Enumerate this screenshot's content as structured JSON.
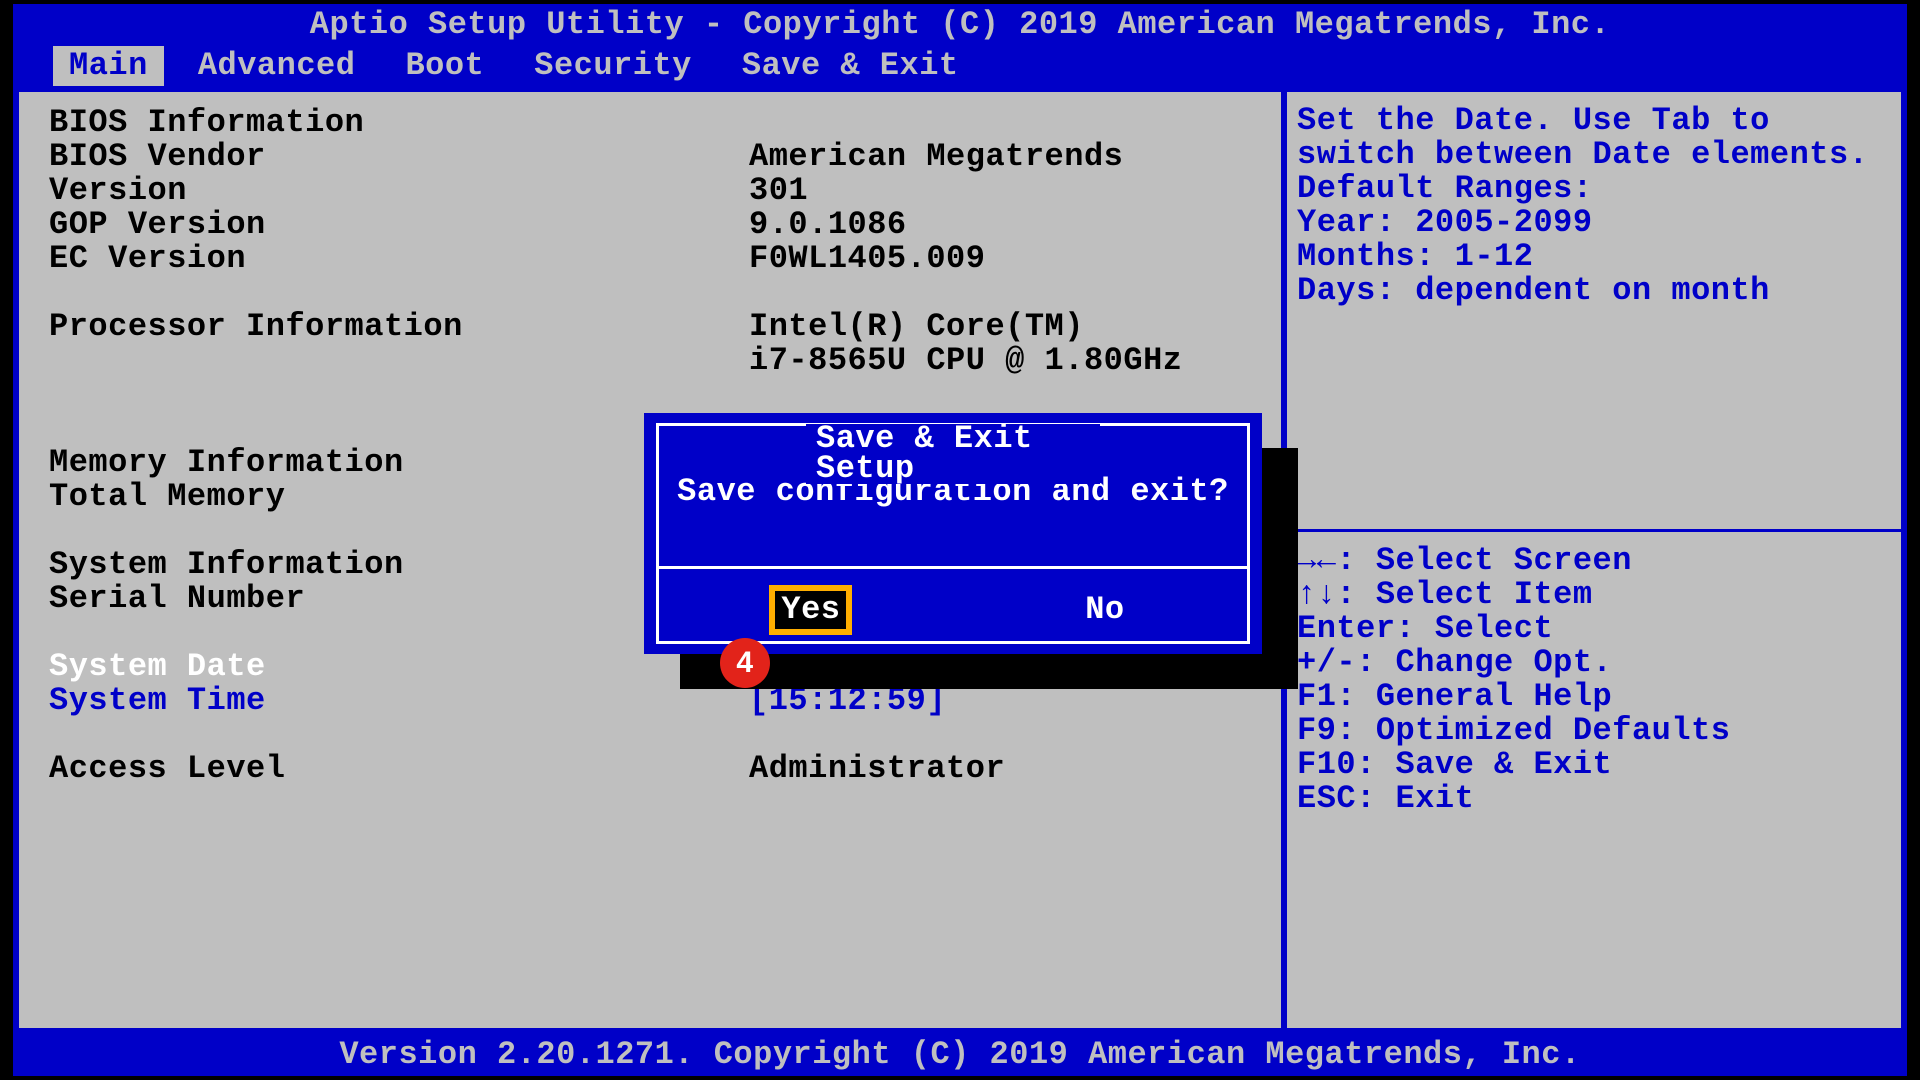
{
  "title": "Aptio Setup Utility - Copyright (C) 2019 American Megatrends, Inc.",
  "footer": "Version 2.20.1271. Copyright (C) 2019 American Megatrends, Inc.",
  "tabs": {
    "main": "Main",
    "advanced": "Advanced",
    "boot": "Boot",
    "security": "Security",
    "saveexit": "Save & Exit"
  },
  "active_tab": "Main",
  "info": {
    "bios_info_hdr": "BIOS Information",
    "bios_vendor_lbl": "BIOS Vendor",
    "bios_vendor_val": "American Megatrends",
    "version_lbl": "Version",
    "version_val": "301",
    "gop_lbl": "GOP Version",
    "gop_val": "9.0.1086",
    "ec_lbl": "EC Version",
    "ec_val": "F0WL1405.009",
    "proc_hdr": "Processor Information",
    "proc_line1": "Intel(R) Core(TM)",
    "proc_line2": "i7-8565U CPU @ 1.80GHz",
    "mem_hdr": "Memory Information",
    "totmem_lbl": "Total Memory",
    "sysinfo_hdr": "System Information",
    "serial_lbl": "Serial Number",
    "sysdate_lbl": "System Date",
    "systime_lbl": "System Time",
    "systime_val": "[15:12:59]",
    "access_lbl": "Access Level",
    "access_val": "Administrator"
  },
  "help": {
    "l1": "Set the Date. Use Tab to",
    "l2": "switch between Date elements.",
    "l3": "Default Ranges:",
    "l4": "Year: 2005-2099",
    "l5": "Months: 1-12",
    "l6": "Days: dependent on month"
  },
  "keys": {
    "k1": "→←: Select Screen",
    "k2": "↑↓: Select Item",
    "k3": "Enter: Select",
    "k4": "+/-: Change Opt.",
    "k5": "F1: General Help",
    "k6": "F9: Optimized Defaults",
    "k7": "F10: Save & Exit",
    "k8": "ESC: Exit"
  },
  "dialog": {
    "title": "Save & Exit Setup",
    "message": "Save configuration and exit?",
    "yes": "Yes",
    "no": "No",
    "focused": "Yes"
  },
  "annotation": {
    "badge4": "4"
  }
}
